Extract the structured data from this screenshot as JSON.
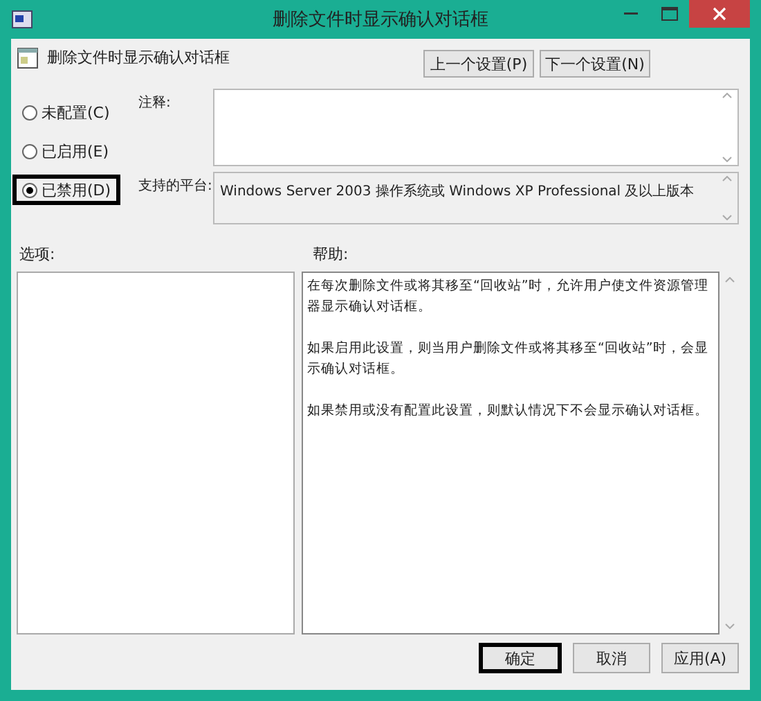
{
  "window": {
    "title": "删除文件时显示确认对话框"
  },
  "policy": {
    "title": "删除文件时显示确认对话框"
  },
  "nav_buttons": [
    "上一个设置(P)",
    "下一个设置(N)"
  ],
  "radio_options": [
    {
      "label": "未配置(C)",
      "selected": false,
      "highlighted": false
    },
    {
      "label": "已启用(E)",
      "selected": false,
      "highlighted": false
    },
    {
      "label": "已禁用(D)",
      "selected": true,
      "highlighted": true
    }
  ],
  "comment": {
    "label": "注释:"
  },
  "platform": {
    "label": "支持的平台:",
    "value": "Windows Server 2003 操作系统或 Windows XP Professional 及以上版本"
  },
  "options": {
    "label": "选项:"
  },
  "help": {
    "label": "帮助:",
    "paragraphs": [
      "在每次删除文件或将其移至“回收站”时，允许用户使文件资源管理器显示确认对话框。",
      "如果启用此设置，则当用户删除文件或将其移至“回收站”时，会显示确认对话框。",
      "如果禁用或没有配置此设置，则默认情况下不会显示确认对话框。"
    ]
  },
  "buttons": [
    {
      "label": "确定",
      "highlighted": true
    },
    {
      "label": "取消",
      "highlighted": false
    },
    {
      "label": "应用(A)",
      "highlighted": false
    }
  ]
}
